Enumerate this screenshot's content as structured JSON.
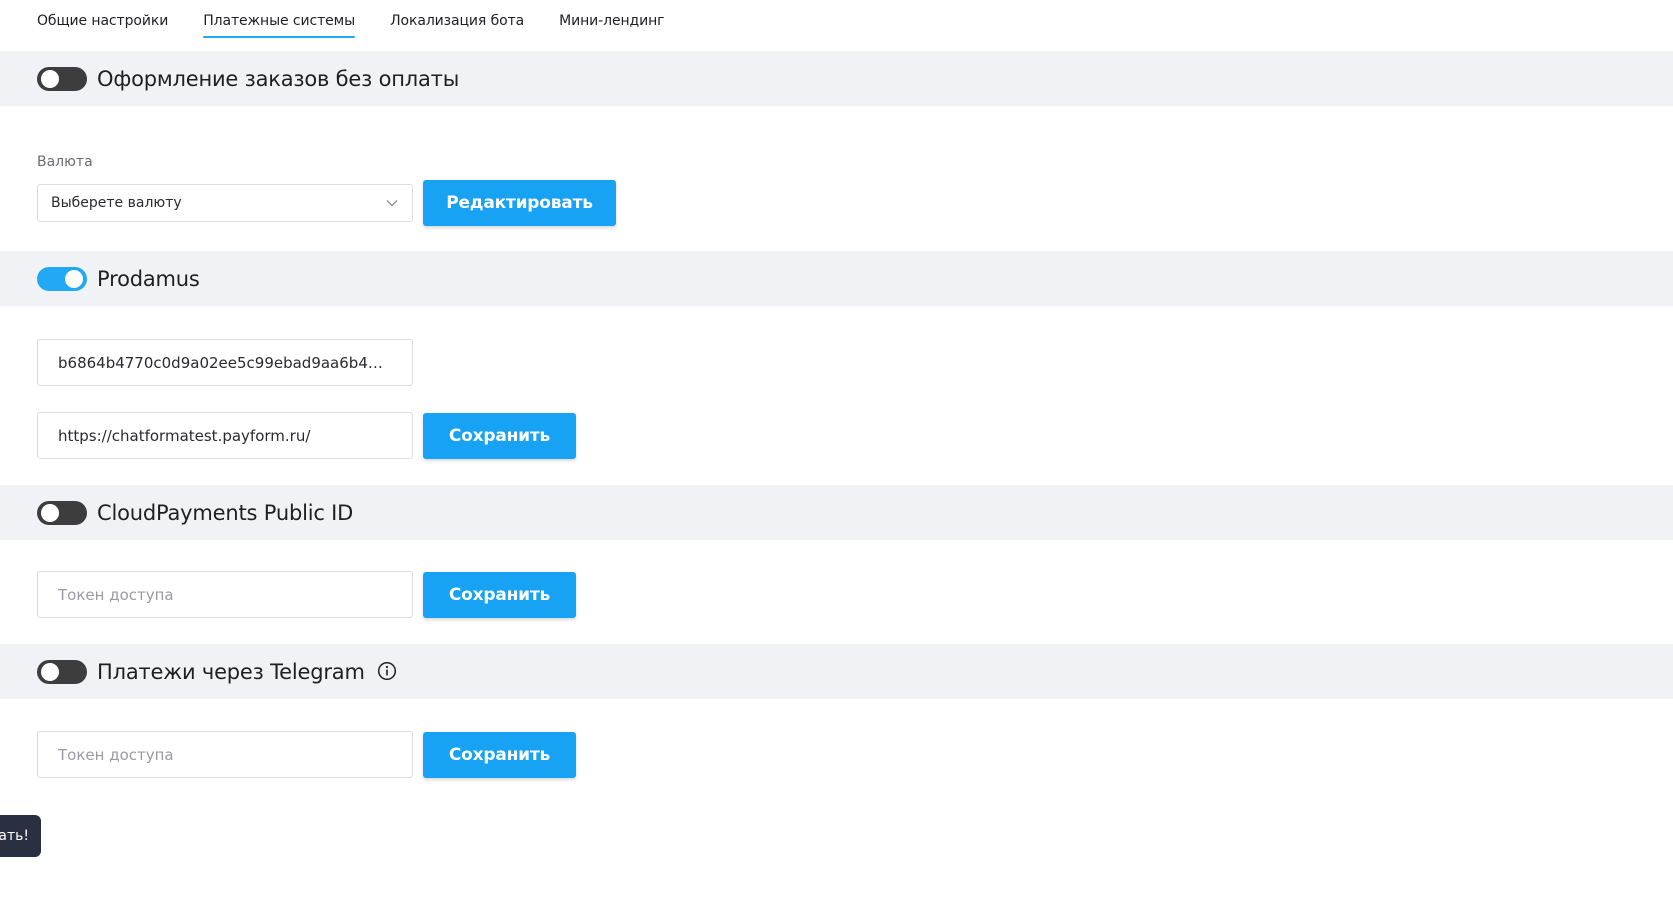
{
  "tabs": [
    {
      "label": "Общие настройки",
      "active": false
    },
    {
      "label": "Платежные системы",
      "active": true
    },
    {
      "label": "Локализация бота",
      "active": false
    },
    {
      "label": "Мини-лендинг",
      "active": false
    }
  ],
  "sections": {
    "no_payment": {
      "title": "Оформление заказов без оплаты",
      "enabled": false,
      "currency_label": "Валюта",
      "currency_value": "Выберете валюту",
      "edit_button": "Редактировать"
    },
    "prodamus": {
      "title": "Prodamus",
      "enabled": true,
      "key_value": "b6864b4770c0d9a02ee5c99ebad9aa6b4b…",
      "url_value": "https://chatformatest.payform.ru/",
      "save_button": "Сохранить"
    },
    "cloudpayments": {
      "title": "CloudPayments Public ID",
      "enabled": false,
      "token_placeholder": "Токен доступа",
      "save_button": "Сохранить"
    },
    "telegram": {
      "title": "Платежи через Telegram",
      "enabled": false,
      "token_placeholder": "Токен доступа",
      "save_button": "Сохранить"
    }
  },
  "toast": {
    "text": "ать!"
  },
  "colors": {
    "accent": "#17a2f4",
    "toggle_off": "#3d3d40",
    "band": "#f1f2f5"
  }
}
